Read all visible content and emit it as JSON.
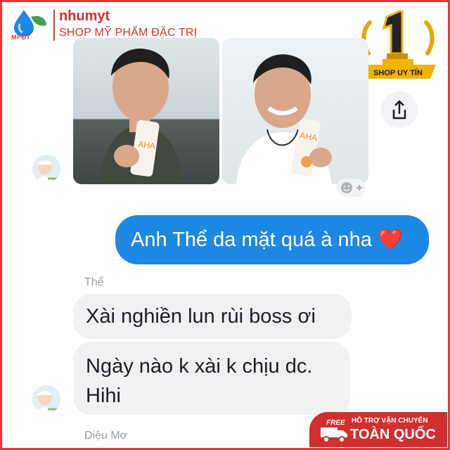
{
  "brand": {
    "logo_text": "MPĐT",
    "name": "nhumyt",
    "tagline": "SHOP MỸ PHẨM ĐẶC TRỊ"
  },
  "badge": {
    "number": "1",
    "label": "SHOP UY TÍN"
  },
  "photos": [
    {
      "product_label": "AHA"
    },
    {
      "product_label": "AHA"
    }
  ],
  "thread": {
    "outgoing": {
      "text": "Anh Thể da mặt quá à nha",
      "emoji": "❤️"
    },
    "sender_1": "Thể",
    "incoming": [
      {
        "lines": [
          "Xài nghiền lun rùi boss ơi"
        ]
      },
      {
        "lines": [
          "Ngày nào k xài k chịu dc.",
          "Hihi"
        ]
      }
    ],
    "sender_2": "Diệu Mơ"
  },
  "shipping": {
    "free": "FREE",
    "top": "HỖ TRỢ VẬN CHUYỂN",
    "main": "TOÀN QUỐC"
  },
  "colors": {
    "accent": "#d32f2f",
    "outgoing_bubble": "#1e88e5",
    "incoming_bubble": "#f0f1f3",
    "gold": "#f0b400"
  },
  "icons": [
    "water-drop-icon",
    "leaf-icon",
    "trophy-icon",
    "share-icon",
    "add-reaction-icon",
    "truck-icon"
  ]
}
